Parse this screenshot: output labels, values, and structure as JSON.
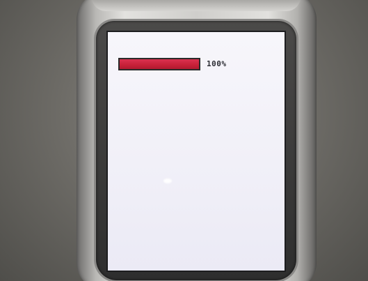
{
  "screen": {
    "progress": {
      "value": 1.0,
      "label": "100%",
      "color": "#c72038"
    }
  },
  "colors": {
    "device_body": "#cfcecb",
    "screen_background": "#f3f2f9",
    "background": "#6f6d68"
  }
}
